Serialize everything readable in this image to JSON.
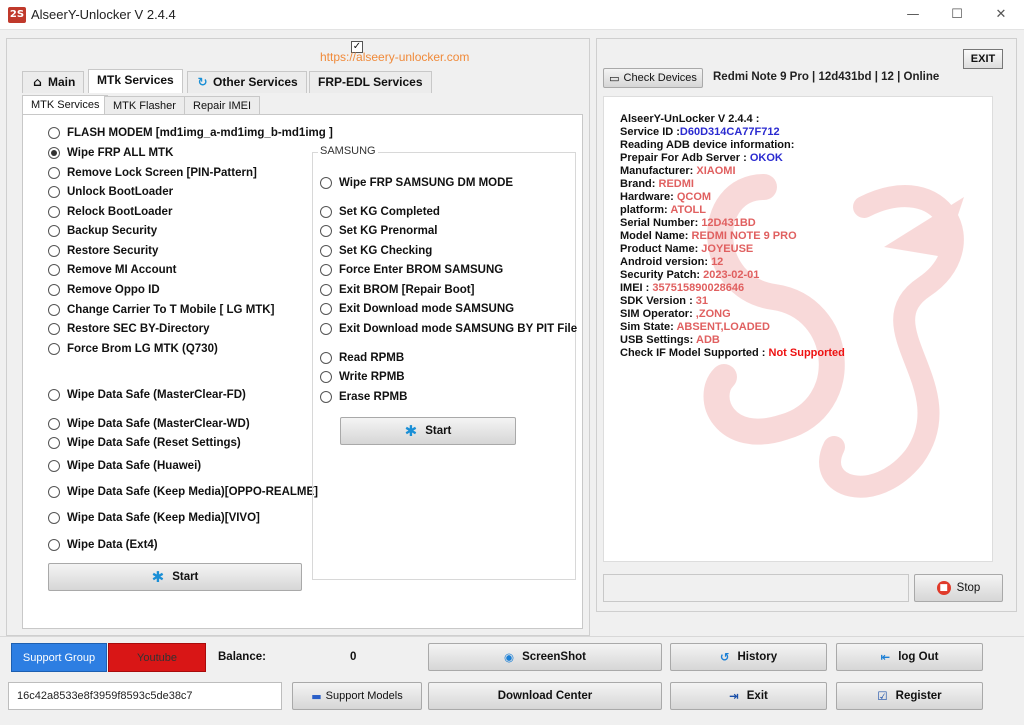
{
  "window": {
    "logo_text": "2S",
    "title": "AlseerY-Unlocker V 2.4.4",
    "minimize": "—",
    "maximize": "☐",
    "close": "✕"
  },
  "website_link": "https://alseery-unlocker.com",
  "tabs": [
    {
      "label": "Main",
      "icon": "home-icon"
    },
    {
      "label": "MTk Services",
      "icon": ""
    },
    {
      "label": "Other Services",
      "icon": "refresh-icon"
    },
    {
      "label": "FRP-EDL Services",
      "icon": ""
    }
  ],
  "subtabs": [
    {
      "label": "MTK Services"
    },
    {
      "label": "MTK Flasher"
    },
    {
      "label": "Repair IMEI"
    }
  ],
  "mtk_options": [
    {
      "label": "FLASH MODEM [md1img_a-md1img_b-md1img ]",
      "checked": false
    },
    {
      "label": "Wipe FRP ALL MTK",
      "checked": true
    },
    {
      "label": "Remove Lock Screen [PIN-Pattern]",
      "checked": false
    },
    {
      "label": "Unlock BootLoader",
      "checked": false
    },
    {
      "label": "Relock BootLoader",
      "checked": false
    },
    {
      "label": "Backup Security",
      "checked": false
    },
    {
      "label": "Restore Security",
      "checked": false
    },
    {
      "label": "Remove MI Account",
      "checked": false
    },
    {
      "label": "Remove Oppo ID",
      "checked": false
    },
    {
      "label": "Change Carrier To T Mobile [ LG MTK]",
      "checked": false
    },
    {
      "label": "Restore SEC  BY-Directory",
      "checked": false
    },
    {
      "label": "Force Brom LG MTK (Q730)",
      "checked": false
    }
  ],
  "wipe_options": [
    {
      "label": "Wipe Data Safe (MasterClear-FD)"
    },
    {
      "label": "Wipe Data Safe (MasterClear-WD)"
    },
    {
      "label": "Wipe Data Safe (Reset Settings)"
    },
    {
      "label": "Wipe Data Safe (Huawei)"
    },
    {
      "label": "Wipe Data Safe (Keep Media)[OPPO-REALME]"
    },
    {
      "label": "Wipe Data Safe (Keep Media)[VIVO]"
    },
    {
      "label": "Wipe Data (Ext4)"
    }
  ],
  "samsung": {
    "group_label": "SAMSUNG",
    "options": [
      {
        "label": "Wipe FRP SAMSUNG DM MODE"
      },
      {
        "label": "Set KG Completed"
      },
      {
        "label": "Set KG Prenormal"
      },
      {
        "label": "Set KG Checking"
      },
      {
        "label": "Force Enter BROM SAMSUNG"
      },
      {
        "label": "Exit BROM [Repair Boot]"
      },
      {
        "label": "Exit Download mode SAMSUNG"
      },
      {
        "label": "Exit Download mode SAMSUNG BY PIT File"
      },
      {
        "label": "Read RPMB"
      },
      {
        "label": "Write RPMB"
      },
      {
        "label": "Erase RPMB"
      }
    ],
    "start_label": "Start"
  },
  "start_label": "Start",
  "check_devices_label": "Check Devices",
  "device_status": "Redmi Note 9 Pro  |  12d431bd  |  12  |  Online",
  "exit_top_label": "EXIT",
  "log": [
    {
      "label": "AlseerY-UnLocker V 2.4.4 :",
      "value": "",
      "color": "plain"
    },
    {
      "label": "Service ID :",
      "value": "D60D314CA77F712",
      "color": "blue"
    },
    {
      "label": "Reading ADB device information:",
      "value": "",
      "color": "plain"
    },
    {
      "label": "Prepair For Adb Server : ",
      "value": "OKOK",
      "color": "blue"
    },
    {
      "label": "Manufacturer: ",
      "value": "XIAOMI",
      "color": "red"
    },
    {
      "label": "Brand: ",
      "value": "REDMI",
      "color": "red"
    },
    {
      "label": "Hardware: ",
      "value": "QCOM",
      "color": "red"
    },
    {
      "label": "platform: ",
      "value": "ATOLL",
      "color": "red"
    },
    {
      "label": "Serial Number: ",
      "value": "12D431BD",
      "color": "red"
    },
    {
      "label": "Model Name: ",
      "value": "REDMI NOTE 9 PRO",
      "color": "red"
    },
    {
      "label": "Product Name: ",
      "value": "JOYEUSE",
      "color": "red"
    },
    {
      "label": "Android version: ",
      "value": "12",
      "color": "red"
    },
    {
      "label": "Security Patch: ",
      "value": "2023-02-01",
      "color": "red"
    },
    {
      "label": "IMEI : ",
      "value": "357515890028646",
      "color": "red"
    },
    {
      "label": "SDK Version : ",
      "value": "31",
      "color": "red"
    },
    {
      "label": "SIM Operator: ",
      "value": ",ZONG",
      "color": "red"
    },
    {
      "label": "Sim State: ",
      "value": "ABSENT,LOADED",
      "color": "red"
    },
    {
      "label": "USB Settings: ",
      "value": "ADB",
      "color": "red"
    },
    {
      "label": "Check IF Model Supported : ",
      "value": "Not Supported",
      "color": "bright"
    }
  ],
  "stop_label": "Stop",
  "bottom": {
    "support_group": "Support Group",
    "youtube": "Youtube",
    "balance_label": "Balance:",
    "balance_value": "0",
    "serial": "16c42a8533e8f3959f8593c5de38c7",
    "support_models": "Support Models",
    "screenshot": "ScreenShot",
    "download_center": "Download  Center",
    "history": "History",
    "exit": "Exit",
    "logout": "log Out",
    "register": "Register"
  },
  "colors": {
    "accent_blue": "#2d7ee2",
    "youtube_red": "#d91616",
    "link_orange": "#f08a3a",
    "log_red": "#e06060",
    "log_blue": "#2a2ad0"
  }
}
